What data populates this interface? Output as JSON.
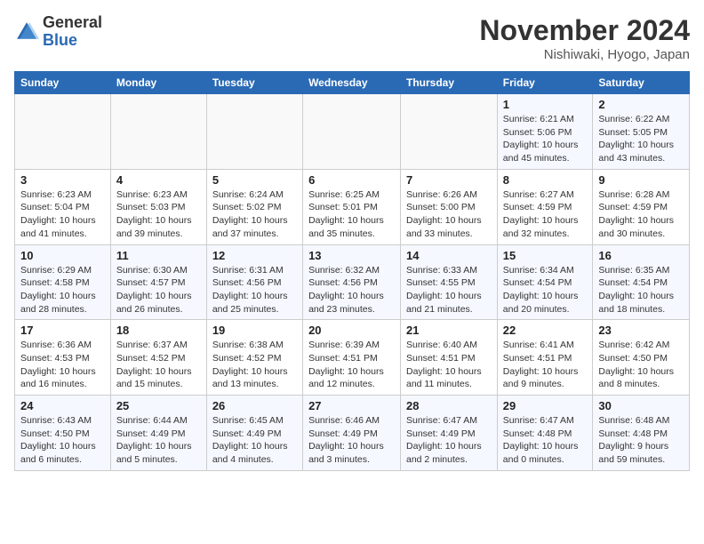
{
  "logo": {
    "line1": "General",
    "line2": "Blue"
  },
  "title": "November 2024",
  "location": "Nishiwaki, Hyogo, Japan",
  "weekdays": [
    "Sunday",
    "Monday",
    "Tuesday",
    "Wednesday",
    "Thursday",
    "Friday",
    "Saturday"
  ],
  "weeks": [
    [
      {
        "day": "",
        "info": ""
      },
      {
        "day": "",
        "info": ""
      },
      {
        "day": "",
        "info": ""
      },
      {
        "day": "",
        "info": ""
      },
      {
        "day": "",
        "info": ""
      },
      {
        "day": "1",
        "info": "Sunrise: 6:21 AM\nSunset: 5:06 PM\nDaylight: 10 hours\nand 45 minutes."
      },
      {
        "day": "2",
        "info": "Sunrise: 6:22 AM\nSunset: 5:05 PM\nDaylight: 10 hours\nand 43 minutes."
      }
    ],
    [
      {
        "day": "3",
        "info": "Sunrise: 6:23 AM\nSunset: 5:04 PM\nDaylight: 10 hours\nand 41 minutes."
      },
      {
        "day": "4",
        "info": "Sunrise: 6:23 AM\nSunset: 5:03 PM\nDaylight: 10 hours\nand 39 minutes."
      },
      {
        "day": "5",
        "info": "Sunrise: 6:24 AM\nSunset: 5:02 PM\nDaylight: 10 hours\nand 37 minutes."
      },
      {
        "day": "6",
        "info": "Sunrise: 6:25 AM\nSunset: 5:01 PM\nDaylight: 10 hours\nand 35 minutes."
      },
      {
        "day": "7",
        "info": "Sunrise: 6:26 AM\nSunset: 5:00 PM\nDaylight: 10 hours\nand 33 minutes."
      },
      {
        "day": "8",
        "info": "Sunrise: 6:27 AM\nSunset: 4:59 PM\nDaylight: 10 hours\nand 32 minutes."
      },
      {
        "day": "9",
        "info": "Sunrise: 6:28 AM\nSunset: 4:59 PM\nDaylight: 10 hours\nand 30 minutes."
      }
    ],
    [
      {
        "day": "10",
        "info": "Sunrise: 6:29 AM\nSunset: 4:58 PM\nDaylight: 10 hours\nand 28 minutes."
      },
      {
        "day": "11",
        "info": "Sunrise: 6:30 AM\nSunset: 4:57 PM\nDaylight: 10 hours\nand 26 minutes."
      },
      {
        "day": "12",
        "info": "Sunrise: 6:31 AM\nSunset: 4:56 PM\nDaylight: 10 hours\nand 25 minutes."
      },
      {
        "day": "13",
        "info": "Sunrise: 6:32 AM\nSunset: 4:56 PM\nDaylight: 10 hours\nand 23 minutes."
      },
      {
        "day": "14",
        "info": "Sunrise: 6:33 AM\nSunset: 4:55 PM\nDaylight: 10 hours\nand 21 minutes."
      },
      {
        "day": "15",
        "info": "Sunrise: 6:34 AM\nSunset: 4:54 PM\nDaylight: 10 hours\nand 20 minutes."
      },
      {
        "day": "16",
        "info": "Sunrise: 6:35 AM\nSunset: 4:54 PM\nDaylight: 10 hours\nand 18 minutes."
      }
    ],
    [
      {
        "day": "17",
        "info": "Sunrise: 6:36 AM\nSunset: 4:53 PM\nDaylight: 10 hours\nand 16 minutes."
      },
      {
        "day": "18",
        "info": "Sunrise: 6:37 AM\nSunset: 4:52 PM\nDaylight: 10 hours\nand 15 minutes."
      },
      {
        "day": "19",
        "info": "Sunrise: 6:38 AM\nSunset: 4:52 PM\nDaylight: 10 hours\nand 13 minutes."
      },
      {
        "day": "20",
        "info": "Sunrise: 6:39 AM\nSunset: 4:51 PM\nDaylight: 10 hours\nand 12 minutes."
      },
      {
        "day": "21",
        "info": "Sunrise: 6:40 AM\nSunset: 4:51 PM\nDaylight: 10 hours\nand 11 minutes."
      },
      {
        "day": "22",
        "info": "Sunrise: 6:41 AM\nSunset: 4:51 PM\nDaylight: 10 hours\nand 9 minutes."
      },
      {
        "day": "23",
        "info": "Sunrise: 6:42 AM\nSunset: 4:50 PM\nDaylight: 10 hours\nand 8 minutes."
      }
    ],
    [
      {
        "day": "24",
        "info": "Sunrise: 6:43 AM\nSunset: 4:50 PM\nDaylight: 10 hours\nand 6 minutes."
      },
      {
        "day": "25",
        "info": "Sunrise: 6:44 AM\nSunset: 4:49 PM\nDaylight: 10 hours\nand 5 minutes."
      },
      {
        "day": "26",
        "info": "Sunrise: 6:45 AM\nSunset: 4:49 PM\nDaylight: 10 hours\nand 4 minutes."
      },
      {
        "day": "27",
        "info": "Sunrise: 6:46 AM\nSunset: 4:49 PM\nDaylight: 10 hours\nand 3 minutes."
      },
      {
        "day": "28",
        "info": "Sunrise: 6:47 AM\nSunset: 4:49 PM\nDaylight: 10 hours\nand 2 minutes."
      },
      {
        "day": "29",
        "info": "Sunrise: 6:47 AM\nSunset: 4:48 PM\nDaylight: 10 hours\nand 0 minutes."
      },
      {
        "day": "30",
        "info": "Sunrise: 6:48 AM\nSunset: 4:48 PM\nDaylight: 9 hours\nand 59 minutes."
      }
    ]
  ]
}
